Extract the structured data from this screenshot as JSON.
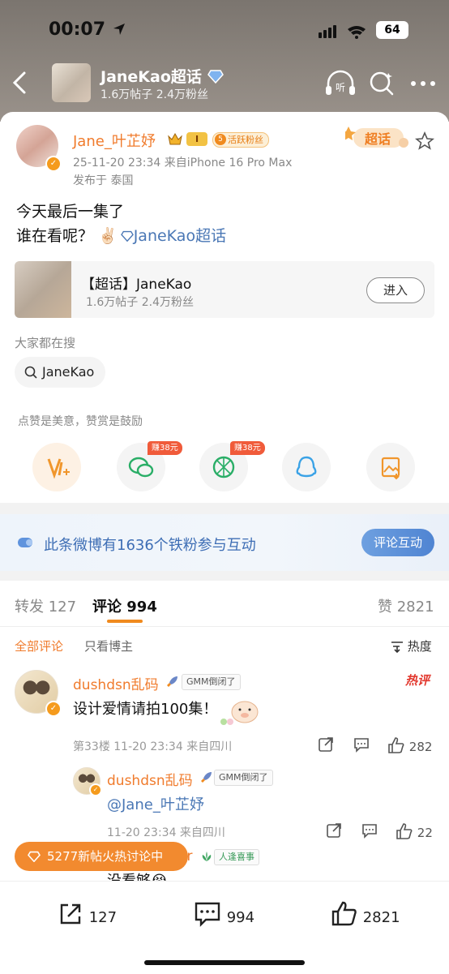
{
  "status": {
    "time": "00:07",
    "battery": "64"
  },
  "topic_header": {
    "title": "JaneKao超话",
    "subtitle": "1.6万帖子 2.4万粉丝"
  },
  "post": {
    "author": "Jane_叶芷妤",
    "level": "I",
    "fan_badge": "活跃粉丝",
    "fan_badge_num": "5",
    "meta": "25-11-20 23:34  来自iPhone 16 Pro Max",
    "location": "发布于 泰国",
    "chaohua_logo": "超话",
    "line1": "今天最后一集了",
    "line2_prefix": "谁在看呢？ ✌🏻",
    "line2_tag": "JaneKao超话",
    "topic_card": {
      "title": "【超话】JaneKao",
      "subtitle": "1.6万帖子 2.4万粉丝",
      "button": "进入"
    },
    "search_label": "大家都在搜",
    "search_chip": "JaneKao",
    "like_hint": "点赞是美意，赞赏是鼓励",
    "earn_badges": [
      "赚38元",
      "赚38元"
    ]
  },
  "banner": {
    "text": "此条微博有1636个铁粉参与互动",
    "button": "评论互动"
  },
  "tabs": {
    "repost": "转发 127",
    "comment": "评论 994",
    "like": "赞 2821"
  },
  "filters": {
    "all": "全部评论",
    "owner": "只看博主",
    "sort": "热度"
  },
  "comments": [
    {
      "name": "dushdsn乱码",
      "badge": "GMM倒闭了",
      "tag": "热评",
      "text": "设计爱情请拍100集！",
      "meta": "第33楼 11-20 23:34 来自四川",
      "likes": "282"
    },
    {
      "name": "dushdsn乱码",
      "badge": "GMM倒闭了",
      "text": "@Jane_叶芷妤",
      "meta": "11-20 23:34 来自四川",
      "likes": "22"
    },
    {
      "name_partial": "er",
      "badge": "人逢喜事",
      "text": "没看够😭"
    }
  ],
  "floating_pill": "5277新帖火热讨论中",
  "bottom_bar": {
    "repost": "127",
    "comment": "994",
    "like": "2821"
  },
  "colors": {
    "accent_orange": "#f07b2c",
    "link_blue": "#4a77b5",
    "banner_blue": "#4f84d2"
  }
}
